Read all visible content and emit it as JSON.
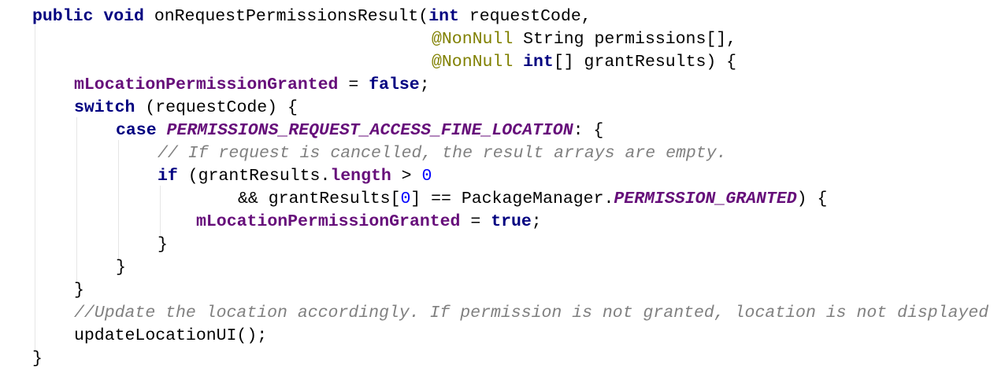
{
  "code": {
    "line1": {
      "kw1": "public",
      "kw2": "void",
      "method": "onRequestPermissionsResult(",
      "kw3": "int",
      "rest": "requestCode,"
    },
    "line2": {
      "annotation": "@NonNull",
      "rest": "String permissions[],"
    },
    "line3": {
      "annotation": "@NonNull",
      "kw": "int",
      "rest": "[] grantResults) {"
    },
    "line4": {
      "field": "mLocationPermissionGranted",
      "op": " = ",
      "kw": "false",
      "semi": ";"
    },
    "line5": {
      "kw": "switch",
      "rest": " (requestCode) {"
    },
    "line6": {
      "kw": "case",
      "constant": "PERMISSIONS_REQUEST_ACCESS_FINE_LOCATION",
      "rest": ": {"
    },
    "line7": {
      "comment": "// If request is cancelled, the result arrays are empty."
    },
    "line8": {
      "kw": "if",
      "mid": " (grantResults.",
      "field": "length",
      "op": " > ",
      "num": "0"
    },
    "line9": {
      "pre": "&& grantResults[",
      "num": "0",
      "mid": "] == PackageManager.",
      "constant": "PERMISSION_GRANTED",
      "rest": ") {"
    },
    "line10": {
      "field": "mLocationPermissionGranted",
      "op": " = ",
      "kw": "true",
      "semi": ";"
    },
    "line11": {
      "text": "}"
    },
    "line12": {
      "text": "}"
    },
    "line13": {
      "text": "}"
    },
    "line14": {
      "comment": "//Update the location accordingly. If permission is not granted, location is not displayed"
    },
    "line15": {
      "text": "updateLocationUI();"
    },
    "line16": {
      "text": "}"
    }
  },
  "colors": {
    "keyword": "#000080",
    "annotation": "#808000",
    "field": "#660e7a",
    "number": "#0000ff",
    "comment": "#808080",
    "text": "#000000",
    "indent_guide": "#e6e6e6"
  }
}
